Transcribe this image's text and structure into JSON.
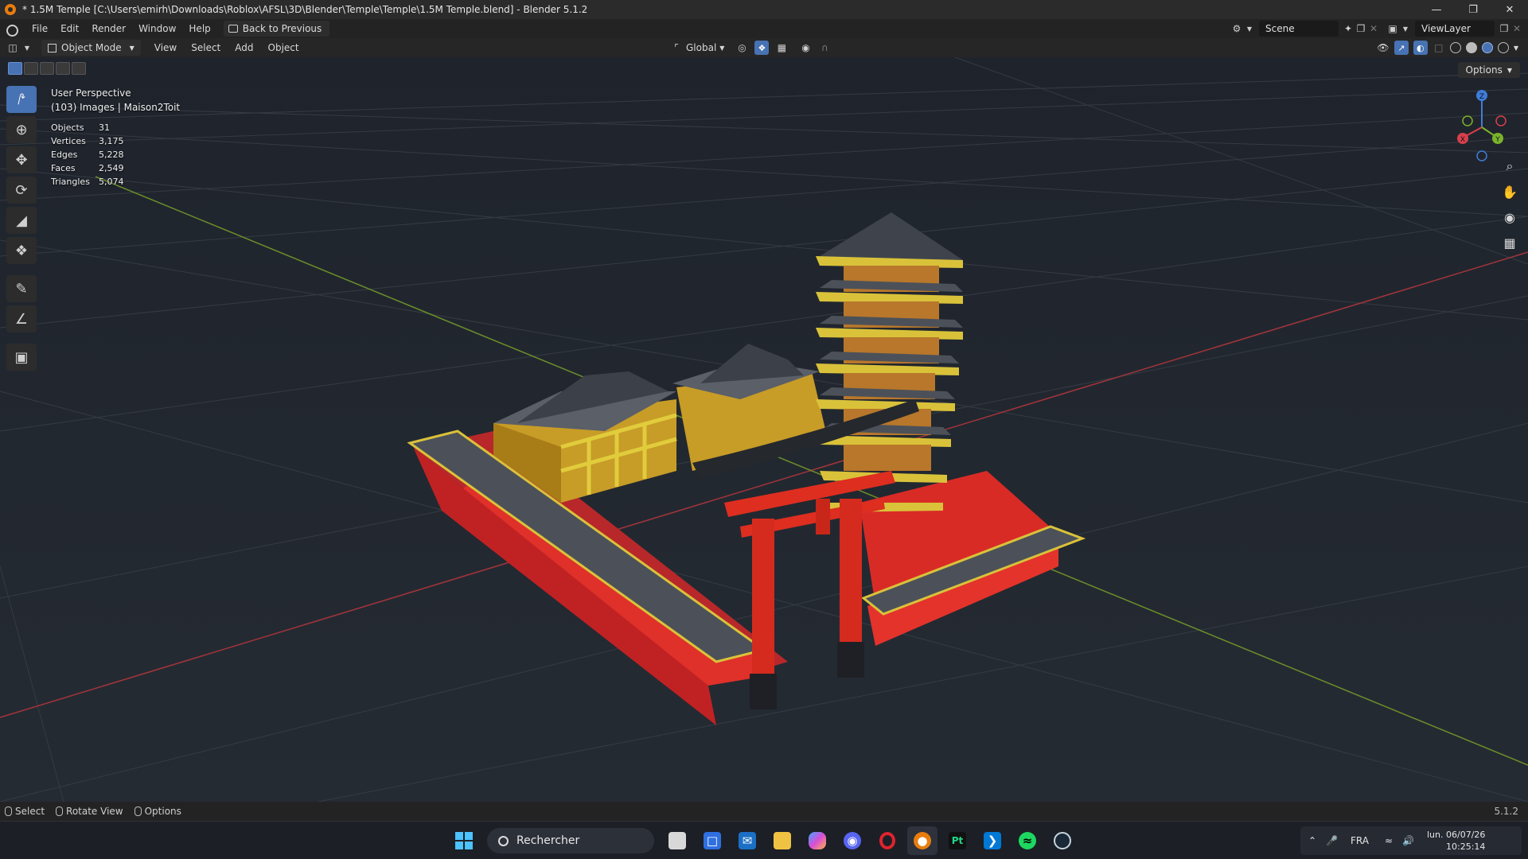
{
  "window": {
    "title": "* 1.5M Temple [C:\\Users\\emirh\\Downloads\\Roblox\\AFSL\\3D\\Blender\\Temple\\Temple\\1.5M Temple.blend] - Blender 5.1.2"
  },
  "menu": {
    "items": [
      "File",
      "Edit",
      "Render",
      "Window",
      "Help"
    ],
    "back_label": "Back to Previous",
    "scene": "Scene",
    "view_layer": "ViewLayer"
  },
  "header": {
    "mode": "Object Mode",
    "menus": [
      "View",
      "Select",
      "Add",
      "Object"
    ],
    "orientation": "Global"
  },
  "viewport": {
    "options_label": "Options",
    "perspective": "User Perspective",
    "collection": "(103) Images | Maison2Toit",
    "stats": [
      {
        "label": "Objects",
        "value": "31"
      },
      {
        "label": "Vertices",
        "value": "3,175"
      },
      {
        "label": "Edges",
        "value": "5,228"
      },
      {
        "label": "Faces",
        "value": "2,549"
      },
      {
        "label": "Triangles",
        "value": "5,074"
      }
    ],
    "gizmo": {
      "x": "X",
      "y": "Y",
      "z": "Z"
    }
  },
  "statusbar": {
    "hints": [
      "Select",
      "Rotate View",
      "Options"
    ],
    "version": "5.1.2"
  },
  "taskbar": {
    "search_placeholder": "Rechercher",
    "language": "FRA",
    "date": "lun. 06/07/26",
    "time": "10:25:14"
  },
  "colors": {
    "accent": "#4772b3",
    "torii_red": "#d42b1e",
    "temple_gold": "#d9c23a",
    "roof_gray": "#4a4f57"
  }
}
